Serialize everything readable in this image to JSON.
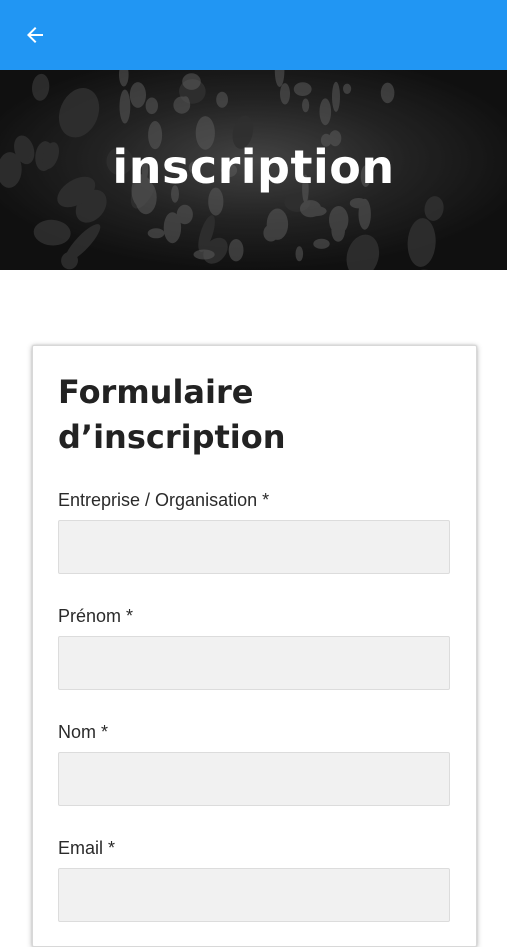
{
  "header": {
    "back_icon": "arrow-left-icon",
    "background_color": "#2196f3"
  },
  "hero": {
    "title": "inscription"
  },
  "form": {
    "title": "Formulaire d’inscription",
    "fields": [
      {
        "label": "Entreprise / Organisation *",
        "value": "",
        "placeholder": ""
      },
      {
        "label": "Prénom *",
        "value": "",
        "placeholder": ""
      },
      {
        "label": "Nom *",
        "value": "",
        "placeholder": ""
      },
      {
        "label": "Email *",
        "value": "",
        "placeholder": ""
      }
    ]
  }
}
